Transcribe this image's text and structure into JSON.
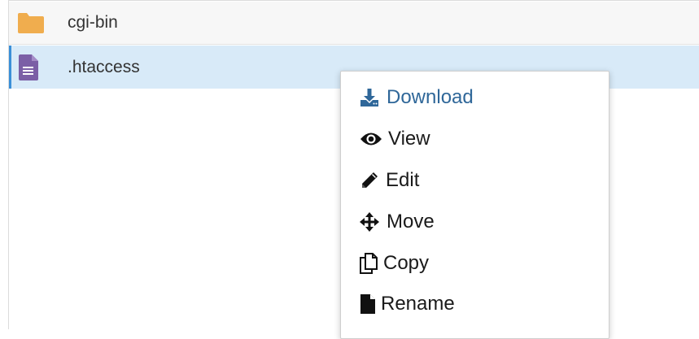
{
  "files": {
    "rows": [
      {
        "name": "cgi-bin",
        "icon": "folder-icon",
        "icon_color": "#f0ad4e",
        "selected": false
      },
      {
        "name": ".htaccess",
        "icon": "file-text-icon",
        "icon_color": "#7b5fa6",
        "selected": true
      }
    ]
  },
  "context_menu": {
    "items": [
      {
        "label": "Download",
        "icon": "download-icon",
        "color": "#2f6799"
      },
      {
        "label": "View",
        "icon": "eye-icon"
      },
      {
        "label": "Edit",
        "icon": "pencil-icon"
      },
      {
        "label": "Move",
        "icon": "move-arrows-icon"
      },
      {
        "label": "Copy",
        "icon": "copy-icon"
      },
      {
        "label": "Rename",
        "icon": "file-icon"
      }
    ]
  },
  "colors": {
    "selected_row_bg": "#d8eaf8",
    "selected_row_accent": "#3a8fd8"
  }
}
